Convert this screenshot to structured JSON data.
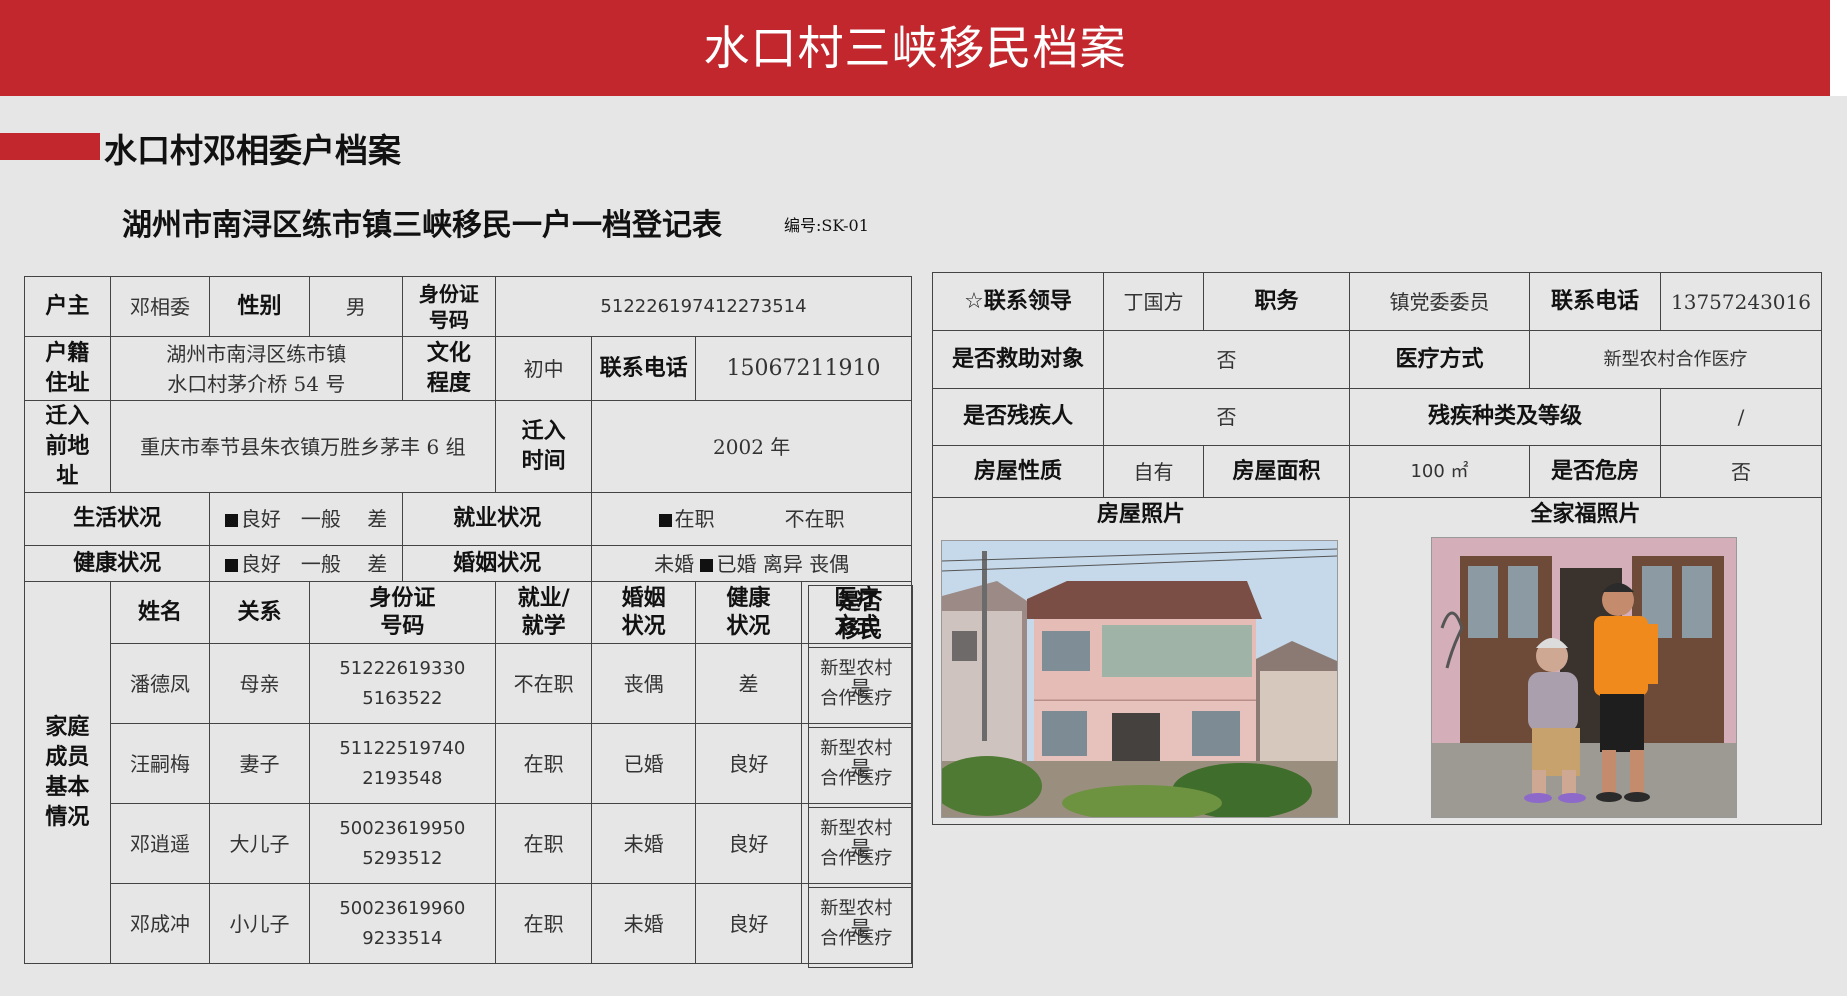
{
  "banner": {
    "title": "水口村三峡移民档案"
  },
  "section": {
    "title": "水口村邓相委户档案"
  },
  "form": {
    "title": "湖州市南浔区练市镇三峡移民一户一档登记表",
    "code": "编号:SK-01"
  },
  "left": {
    "head_label": "户主",
    "head_name": "邓相委",
    "gender_label": "性别",
    "gender": "男",
    "id_label_1": "身份证",
    "id_label_2": "号码",
    "id": "512226197412273514",
    "hukou_label_1": "户籍",
    "hukou_label_2": "住址",
    "hukou_1": "湖州市南浔区练市镇",
    "hukou_2": "水口村茅介桥 54 号",
    "edu_label_1": "文化",
    "edu_label_2": "程度",
    "edu": "初中",
    "phone_label": "联系电话",
    "phone": "15067211910",
    "from_label_1": "迁入",
    "from_label_2": "前地",
    "from_label_3": "址",
    "from": "重庆市奉节县朱衣镇万胜乡茅丰 6 组",
    "move_time_label_1": "迁入",
    "move_time_label_2": "时间",
    "move_time": "2002 年",
    "living_label": "生活状况",
    "living_good": "良好",
    "living_opts": "一般　 差",
    "employ_label": "就业状况",
    "employ_yes": "在职",
    "employ_no": "不在职",
    "health_label": "健康状况",
    "health_good": "良好",
    "health_opts": "一般　 差",
    "marriage_label": "婚姻状况",
    "marriage_pre": "未婚",
    "marriage_sel": "已婚",
    "marriage_post": "离异  丧偶",
    "family_label_1": "家庭",
    "family_label_2": "成员",
    "family_label_3": "基本",
    "family_label_4": "情况",
    "cols": {
      "name": "姓名",
      "rel": "关系",
      "id_1": "身份证",
      "id_2": "号码",
      "job_1": "就业/",
      "job_2": "就学",
      "mar_1": "婚姻",
      "mar_2": "状况",
      "hl_1": "健康",
      "hl_2": "状况",
      "med_1": "医疗",
      "med_2": "方式",
      "mig_1": "是否",
      "mig_2": "移民"
    },
    "members": [
      {
        "name": "潘德凤",
        "rel": "母亲",
        "id_1": "51222619330",
        "id_2": "5163522",
        "job": "不在职",
        "mar": "丧偶",
        "health": "差",
        "med_1": "新型农村",
        "med_2": "合作医疗",
        "mig": "是"
      },
      {
        "name": "汪嗣梅",
        "rel": "妻子",
        "id_1": "51122519740",
        "id_2": "2193548",
        "job": "在职",
        "mar": "已婚",
        "health": "良好",
        "med_1": "新型农村",
        "med_2": "合作医疗",
        "mig": "是"
      },
      {
        "name": "邓逍遥",
        "rel": "大儿子",
        "id_1": "50023619950",
        "id_2": "5293512",
        "job": "在职",
        "mar": "未婚",
        "health": "良好",
        "med_1": "新型农村",
        "med_2": "合作医疗",
        "mig": "是"
      },
      {
        "name": "邓成冲",
        "rel": "小儿子",
        "id_1": "50023619960",
        "id_2": "9233514",
        "job": "在职",
        "mar": "未婚",
        "health": "良好",
        "med_1": "新型农村",
        "med_2": "合作医疗",
        "mig": "是"
      }
    ]
  },
  "right": {
    "leader_label": "☆联系领导",
    "leader": "丁国方",
    "post_label": "职务",
    "post": "镇党委委员",
    "phone_label": "联系电话",
    "phone": "13757243016",
    "aid_label": "是否救助对象",
    "aid": "否",
    "medical_label": "医疗方式",
    "medical": "新型农村合作医疗",
    "disabled_label": "是否残疾人",
    "disabled": "否",
    "disability_label": "残疾种类及等级",
    "disability": "/",
    "house_nature_label": "房屋性质",
    "house_nature": "自有",
    "house_area_label": "房屋面积",
    "house_area": "100 ㎡",
    "danger_label": "是否危房",
    "danger": "否",
    "house_photo_label": "房屋照片",
    "family_photo_label": "全家福照片"
  }
}
